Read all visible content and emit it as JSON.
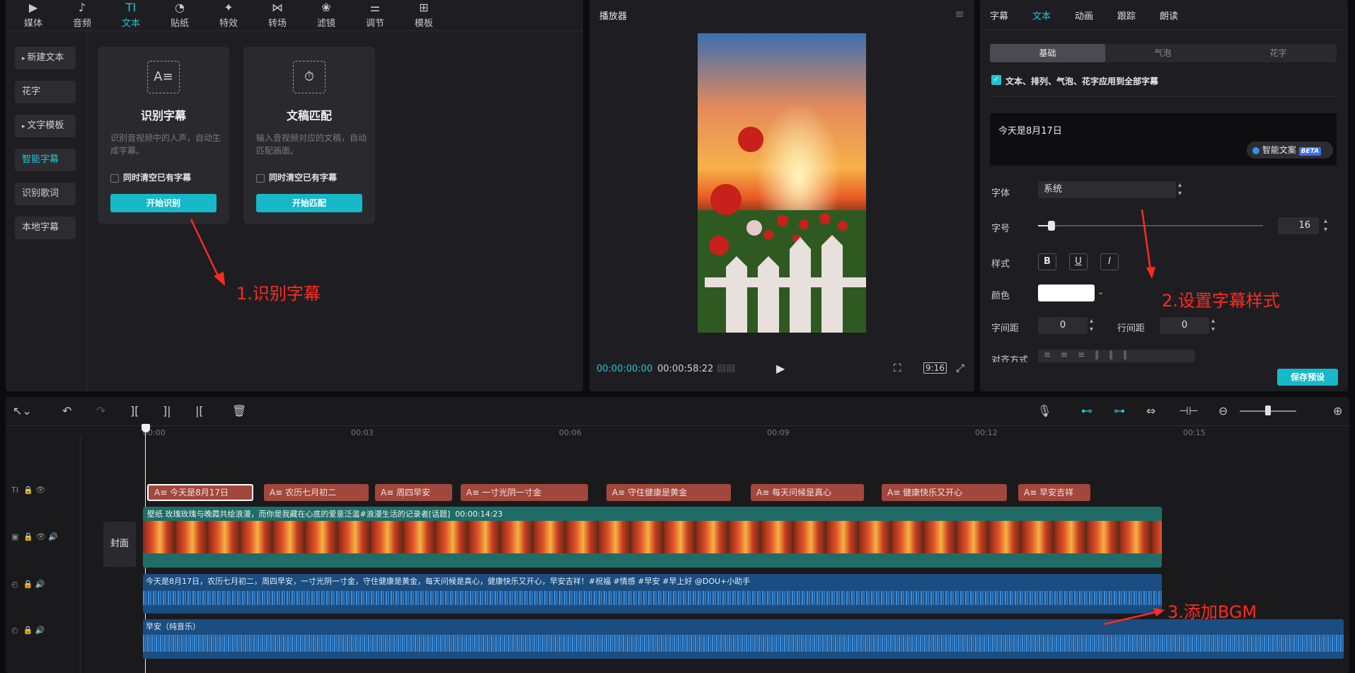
{
  "top_tabs": [
    {
      "label": "媒体",
      "icon": "media-icon"
    },
    {
      "label": "音频",
      "icon": "audio-icon"
    },
    {
      "label": "文本",
      "icon": "text-icon",
      "active": true
    },
    {
      "label": "贴纸",
      "icon": "sticker-icon"
    },
    {
      "label": "特效",
      "icon": "effects-icon"
    },
    {
      "label": "转场",
      "icon": "transition-icon"
    },
    {
      "label": "滤镜",
      "icon": "filter-icon"
    },
    {
      "label": "调节",
      "icon": "adjust-icon"
    },
    {
      "label": "模板",
      "icon": "template-icon"
    }
  ],
  "sidebar": {
    "items": [
      {
        "label": "新建文本",
        "caret": true
      },
      {
        "label": "花字",
        "caret": false
      },
      {
        "label": "文字模板",
        "caret": true
      },
      {
        "label": "智能字幕",
        "caret": false,
        "active": true
      },
      {
        "label": "识别歌词",
        "caret": false
      },
      {
        "label": "本地字幕",
        "caret": false
      }
    ]
  },
  "cards": [
    {
      "title": "识别字幕",
      "desc": "识别音视频中的人声，自动生成字幕。",
      "checkbox": "同时清空已有字幕",
      "button": "开始识别"
    },
    {
      "title": "文稿匹配",
      "desc": "输入音视频对应的文稿，自动匹配画面。",
      "checkbox": "同时清空已有字幕",
      "button": "开始匹配"
    }
  ],
  "annotations": {
    "a1": "1.识别字幕",
    "a2": "2.设置字幕样式",
    "a3": "3.添加BGM"
  },
  "player": {
    "title": "播放器",
    "current_time": "00:00:00:00",
    "total_time": "00:00:58:22",
    "ratio": "9:16"
  },
  "right": {
    "tabs": [
      "字幕",
      "文本",
      "动画",
      "跟踪",
      "朗读"
    ],
    "active_tab": "文本",
    "segments": [
      "基础",
      "气泡",
      "花字"
    ],
    "apply_all": "文本、排列、气泡、花字应用到全部字幕",
    "text_value": "今天是8月17日",
    "smart_label": "智能文案",
    "beta": "BETA",
    "font_label": "字体",
    "font_value": "系统",
    "size_label": "字号",
    "size_value": "16",
    "size_level": 0.06,
    "style_label": "样式",
    "color_label": "颜色",
    "color_value": "#ffffff",
    "spacing_label": "字间距",
    "spacing_value": "0",
    "line_label": "行间距",
    "line_value": "0",
    "align_label": "对齐方式",
    "save_preset": "保存预设"
  },
  "timeline": {
    "ticks": [
      "00:00",
      "00:03",
      "00:06",
      "00:09",
      "00:12",
      "00:15"
    ],
    "cover_label": "封面",
    "subtitle_clips": [
      "今天是8月17日",
      "农历七月初二",
      "周四早安",
      "一寸光阴一寸金",
      "守住健康是黄金",
      "每天问候是真心",
      "健康快乐又开心",
      "早安吉祥"
    ],
    "video_clip_label": "壁纸  玫瑰玫瑰与晚霞共绘浪漫，而你是我藏在心底的爱意泛滥#浪漫生活的记录者[话题]",
    "video_clip_duration": "00:00:14:23",
    "audio_clip_label": "今天是8月17日，农历七月初二，周四早安，一寸光阴一寸金，守住健康是黄金，每天问候是真心，健康快乐又开心，早安吉祥！#祝福 #情感 #早安 #早上好 @DOU+小助手",
    "bgm_clip_label": "早安（纯音乐）"
  }
}
